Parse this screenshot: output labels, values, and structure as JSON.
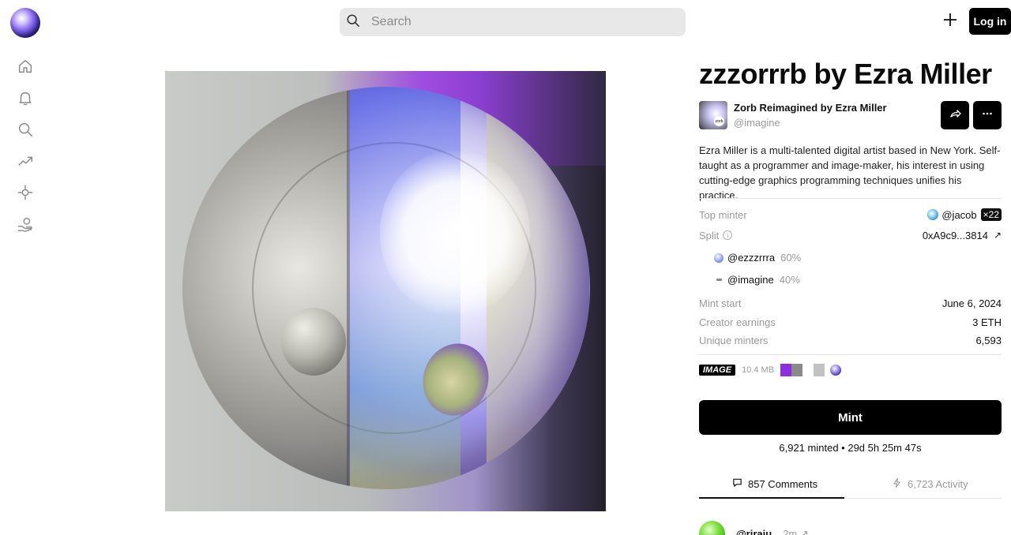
{
  "header": {
    "search_placeholder": "Search",
    "login_label": "Log in",
    "icons": [
      "app-orb-logo",
      "search-icon",
      "plus-icon"
    ]
  },
  "sidebar": {
    "icons": [
      "home-icon",
      "bell-icon",
      "search-icon",
      "trending-icon",
      "crosshair-icon",
      "hand-coin-icon"
    ]
  },
  "artwork": {
    "description_icon": "sphere-artwork-image"
  },
  "token": {
    "title": "zzzorrrb by Ezra Miller",
    "collection_name": "Zorb Reimagined by Ezra Miller",
    "collection_handle": "@imagine",
    "collection_thumb_badge": "zorb",
    "description": "Ezra Miller is a multi-talented digital artist based in New York. Self-taught as a programmer and image-maker, his interest in using cutting-edge graphics programming techniques unifies his practice."
  },
  "details": {
    "top_minter_label": "Top minter",
    "top_minter_value": "@jacob",
    "top_minter_count": "×22",
    "split_label": "Split",
    "split_info_icon": "i",
    "split_address": "0xA9c9...3814",
    "split_arrow": "↗",
    "splits": [
      {
        "name": "@ezzzrrra",
        "pct": "60%"
      },
      {
        "name": "@imagine",
        "pct": "40%"
      }
    ],
    "mint_start_label": "Mint start",
    "mint_start_value": "June 6, 2024",
    "creator_earnings_label": "Creator earnings",
    "creator_earnings_value": "3 ETH",
    "unique_minters_label": "Unique minters",
    "unique_minters_value": "6,593"
  },
  "media": {
    "type": "IMAGE",
    "size": "10.4 MB",
    "palette": [
      "#8d2fe0",
      "#8a8a8a",
      "#c0c2c4"
    ]
  },
  "mint": {
    "button_label": "Mint",
    "status": "6,921 minted • 29d 5h 25m 47s"
  },
  "tabs": {
    "comments_label": "857 Comments",
    "activity_label": "6,723 Activity"
  },
  "comment": {
    "user": "@rjraju",
    "time": "2m ↗"
  },
  "colors": {
    "primary_button": "#000000",
    "muted_text": "#9a9a9a",
    "search_bg": "#e8e8e8"
  }
}
